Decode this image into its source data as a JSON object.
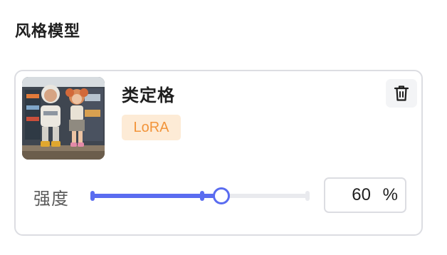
{
  "section": {
    "title": "风格模型"
  },
  "model": {
    "name": "类定格",
    "tag": "LoRA",
    "thumbnail_icon": "stop-motion-dolls-image",
    "delete_icon": "trash-icon"
  },
  "strength": {
    "label": "强度",
    "value": "60",
    "unit": "%",
    "fraction": 0.6
  },
  "colors": {
    "accent": "#5a6cf0",
    "tag_bg": "#fdebd6",
    "tag_text": "#f2943a",
    "border": "#dcdde2"
  }
}
